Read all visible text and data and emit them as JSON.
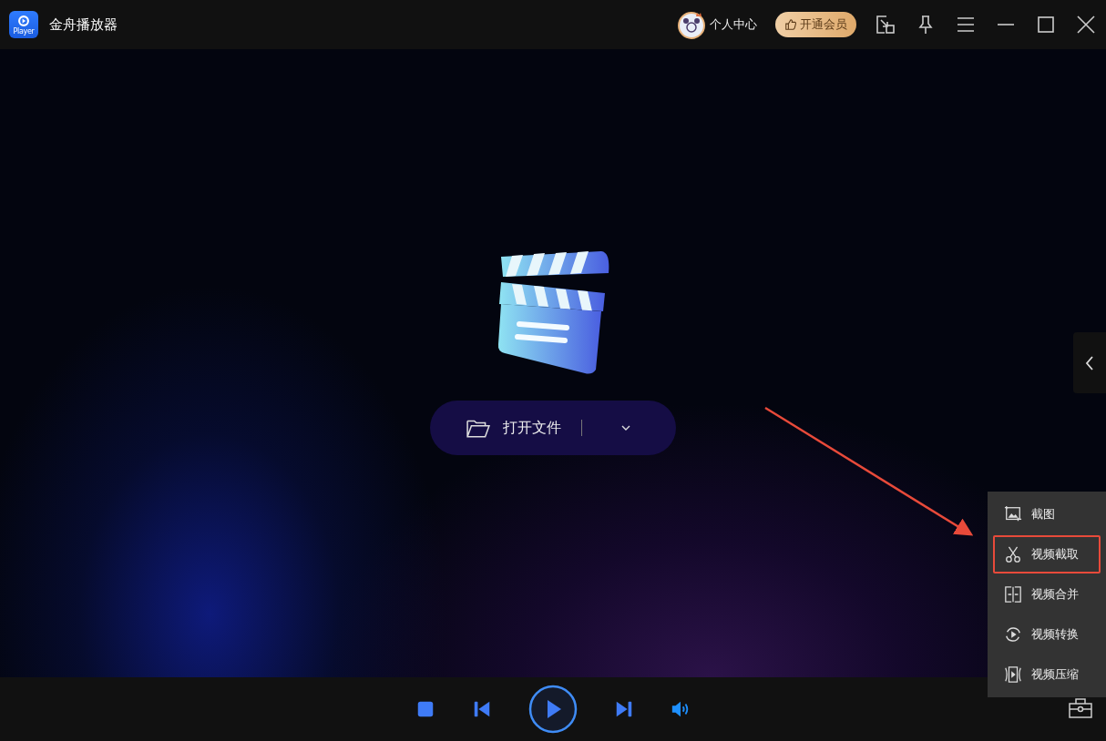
{
  "window": {
    "title": "金舟播放器",
    "logo_text": "Player"
  },
  "header": {
    "user_label": "个人中心",
    "vip_button": "开通会员"
  },
  "open_button": {
    "label": "打开文件"
  },
  "tools_menu": [
    {
      "kind": "screenshot",
      "label": "截图",
      "highlighted": false
    },
    {
      "kind": "cut",
      "label": "视频截取",
      "highlighted": true
    },
    {
      "kind": "merge",
      "label": "视频合并",
      "highlighted": false
    },
    {
      "kind": "convert",
      "label": "视频转换",
      "highlighted": false
    },
    {
      "kind": "compress",
      "label": "视频压缩",
      "highlighted": false
    }
  ]
}
